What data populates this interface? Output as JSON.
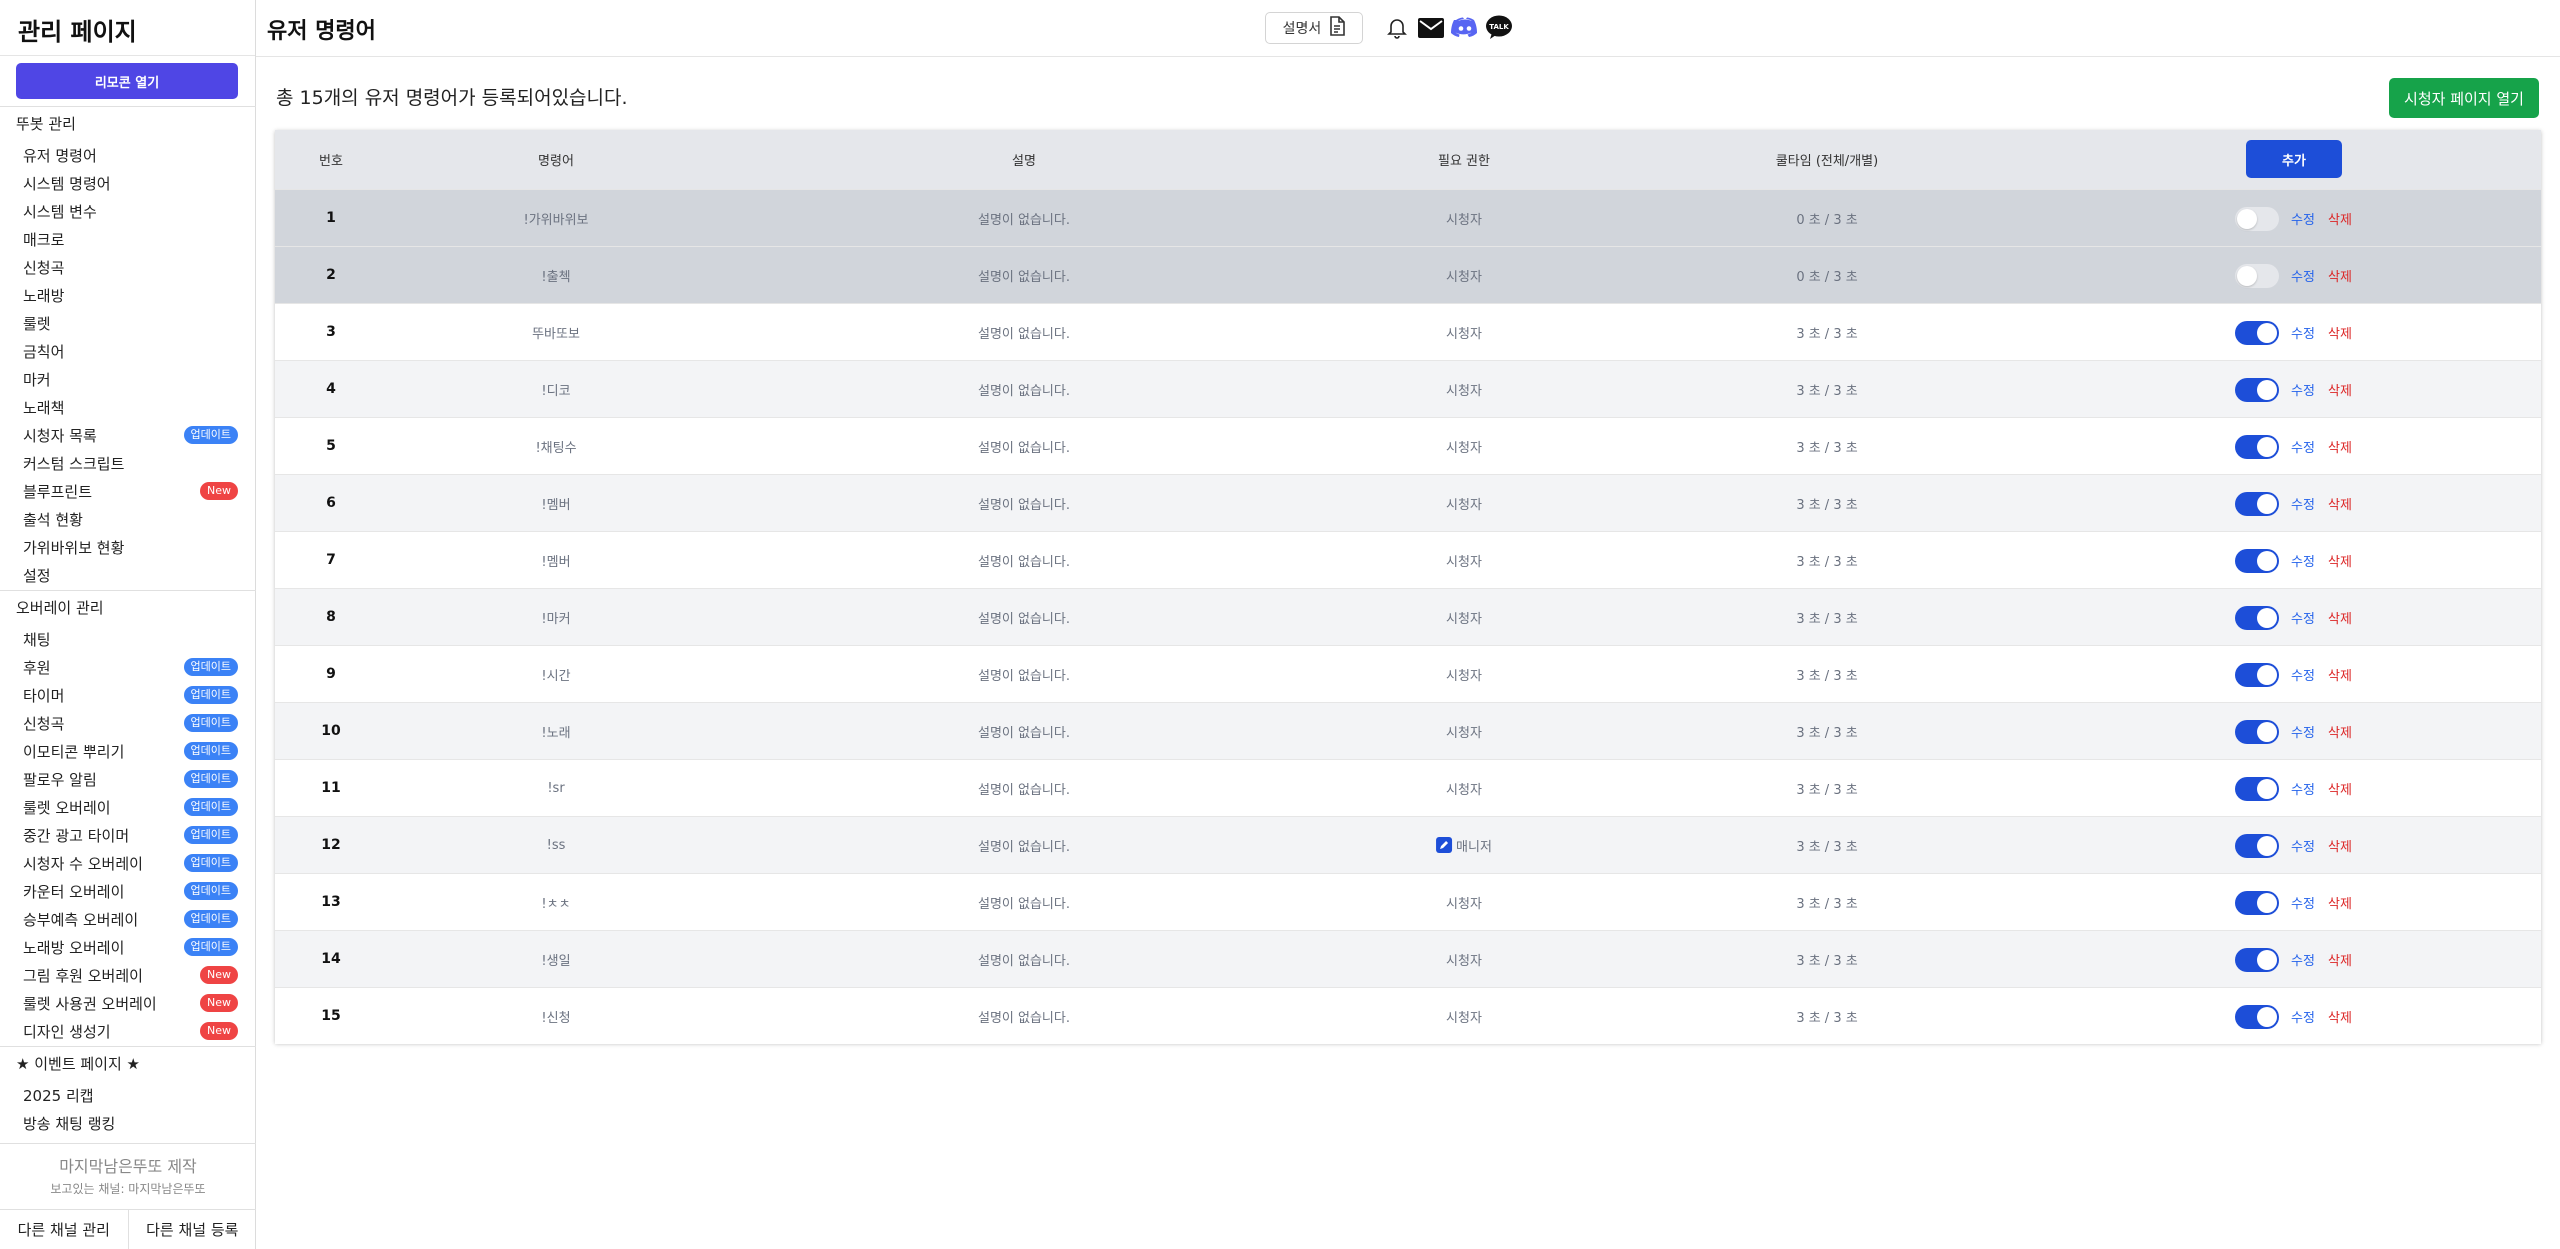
{
  "sidebar": {
    "title": "관리 페이지",
    "remote_button": "리모콘 열기",
    "bot_section": "뚜봇 관리",
    "bot_items": [
      {
        "label": "유저 명령어",
        "badge": ""
      },
      {
        "label": "시스템 명령어",
        "badge": ""
      },
      {
        "label": "시스템 변수",
        "badge": ""
      },
      {
        "label": "매크로",
        "badge": ""
      },
      {
        "label": "신청곡",
        "badge": ""
      },
      {
        "label": "노래방",
        "badge": ""
      },
      {
        "label": "룰렛",
        "badge": ""
      },
      {
        "label": "금칙어",
        "badge": ""
      },
      {
        "label": "마커",
        "badge": ""
      },
      {
        "label": "노래책",
        "badge": ""
      },
      {
        "label": "시청자 목록",
        "badge": "업데이트"
      },
      {
        "label": "커스텀 스크립트",
        "badge": ""
      },
      {
        "label": "블루프린트",
        "badge": "New"
      },
      {
        "label": "출석 현황",
        "badge": ""
      },
      {
        "label": "가위바위보 현황",
        "badge": ""
      },
      {
        "label": "설정",
        "badge": ""
      }
    ],
    "overlay_section": "오버레이 관리",
    "overlay_items": [
      {
        "label": "채팅",
        "badge": ""
      },
      {
        "label": "후원",
        "badge": "업데이트"
      },
      {
        "label": "타이머",
        "badge": "업데이트"
      },
      {
        "label": "신청곡",
        "badge": "업데이트"
      },
      {
        "label": "이모티콘 뿌리기",
        "badge": "업데이트"
      },
      {
        "label": "팔로우 알림",
        "badge": "업데이트"
      },
      {
        "label": "룰렛 오버레이",
        "badge": "업데이트"
      },
      {
        "label": "중간 광고 타이머",
        "badge": "업데이트"
      },
      {
        "label": "시청자 수 오버레이",
        "badge": "업데이트"
      },
      {
        "label": "카운터 오버레이",
        "badge": "업데이트"
      },
      {
        "label": "승부예측 오버레이",
        "badge": "업데이트"
      },
      {
        "label": "노래방 오버레이",
        "badge": "업데이트"
      },
      {
        "label": "그림 후원 오버레이",
        "badge": "New"
      },
      {
        "label": "룰렛 사용권 오버레이",
        "badge": "New"
      },
      {
        "label": "디자인 생성기",
        "badge": "New"
      }
    ],
    "event_section": "★ 이벤트 페이지 ★",
    "event_items": [
      {
        "label": "2025 리캡",
        "badge": ""
      },
      {
        "label": "방송 채팅 랭킹",
        "badge": ""
      }
    ],
    "credit": "마지막남은뚜또 제작",
    "viewing_channel": "보고있는 채널: 마지막남은뚜또",
    "manage_other": "다른 채널 관리",
    "register_other": "다른 채널 등록"
  },
  "header": {
    "title": "유저 명령어",
    "manual_button": "설명서",
    "icons": [
      "bell-icon",
      "mail-icon",
      "discord-icon",
      "kakaotalk-icon"
    ],
    "talk_label": "TALK"
  },
  "main": {
    "summary": "총 15개의 유저 명령어가 등록되어있습니다.",
    "viewer_button": "시청자 페이지 열기",
    "table": {
      "headers": {
        "number": "번호",
        "command": "명령어",
        "description": "설명",
        "permission": "필요 권한",
        "cooldown": "쿨타임 (전체/개별)",
        "add": "추가"
      },
      "edit_label": "수정",
      "delete_label": "삭제",
      "rows": [
        {
          "no": "1",
          "command": "!가위바위보",
          "desc": "설명이 없습니다.",
          "perm": "시청자",
          "perm_icon": false,
          "cooldown": "0 초 / 3 초",
          "enabled": false
        },
        {
          "no": "2",
          "command": "!출첵",
          "desc": "설명이 없습니다.",
          "perm": "시청자",
          "perm_icon": false,
          "cooldown": "0 초 / 3 초",
          "enabled": false
        },
        {
          "no": "3",
          "command": "뚜바또보",
          "desc": "설명이 없습니다.",
          "perm": "시청자",
          "perm_icon": false,
          "cooldown": "3 초 / 3 초",
          "enabled": true
        },
        {
          "no": "4",
          "command": "!디코",
          "desc": "설명이 없습니다.",
          "perm": "시청자",
          "perm_icon": false,
          "cooldown": "3 초 / 3 초",
          "enabled": true
        },
        {
          "no": "5",
          "command": "!채팅수",
          "desc": "설명이 없습니다.",
          "perm": "시청자",
          "perm_icon": false,
          "cooldown": "3 초 / 3 초",
          "enabled": true
        },
        {
          "no": "6",
          "command": "!멤버",
          "desc": "설명이 없습니다.",
          "perm": "시청자",
          "perm_icon": false,
          "cooldown": "3 초 / 3 초",
          "enabled": true
        },
        {
          "no": "7",
          "command": "!멤버",
          "desc": "설명이 없습니다.",
          "perm": "시청자",
          "perm_icon": false,
          "cooldown": "3 초 / 3 초",
          "enabled": true
        },
        {
          "no": "8",
          "command": "!마커",
          "desc": "설명이 없습니다.",
          "perm": "시청자",
          "perm_icon": false,
          "cooldown": "3 초 / 3 초",
          "enabled": true
        },
        {
          "no": "9",
          "command": "!시간",
          "desc": "설명이 없습니다.",
          "perm": "시청자",
          "perm_icon": false,
          "cooldown": "3 초 / 3 초",
          "enabled": true
        },
        {
          "no": "10",
          "command": "!노래",
          "desc": "설명이 없습니다.",
          "perm": "시청자",
          "perm_icon": false,
          "cooldown": "3 초 / 3 초",
          "enabled": true
        },
        {
          "no": "11",
          "command": "!sr",
          "desc": "설명이 없습니다.",
          "perm": "시청자",
          "perm_icon": false,
          "cooldown": "3 초 / 3 초",
          "enabled": true
        },
        {
          "no": "12",
          "command": "!ss",
          "desc": "설명이 없습니다.",
          "perm": "매니저",
          "perm_icon": true,
          "cooldown": "3 초 / 3 초",
          "enabled": true
        },
        {
          "no": "13",
          "command": "!ㅊㅊ",
          "desc": "설명이 없습니다.",
          "perm": "시청자",
          "perm_icon": false,
          "cooldown": "3 초 / 3 초",
          "enabled": true
        },
        {
          "no": "14",
          "command": "!생일",
          "desc": "설명이 없습니다.",
          "perm": "시청자",
          "perm_icon": false,
          "cooldown": "3 초 / 3 초",
          "enabled": true
        },
        {
          "no": "15",
          "command": "!신청",
          "desc": "설명이 없습니다.",
          "perm": "시청자",
          "perm_icon": false,
          "cooldown": "3 초 / 3 초",
          "enabled": true
        }
      ]
    }
  },
  "colors": {
    "accent_purple": "#4f46e5",
    "accent_blue": "#1d4ed8",
    "viewer_green": "#16a34a",
    "update_badge": "#3b82f6",
    "new_badge": "#ef4444",
    "delete_red": "#dc2626",
    "disabled_row": "#d1d5db",
    "striped_row": "#f3f4f6"
  }
}
